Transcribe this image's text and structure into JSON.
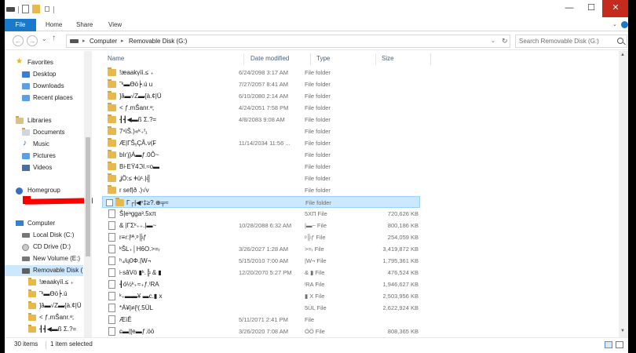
{
  "titlebar": {
    "minimize": "—",
    "maximize": "☐",
    "close": "✕"
  },
  "ribbon": {
    "tabs": [
      "File",
      "Home",
      "Share",
      "View"
    ]
  },
  "address": {
    "crumbs": [
      "Computer",
      "Removable Disk (G:)"
    ],
    "search_placeholder": "Search Removable Disk (G:)"
  },
  "nav": {
    "favorites": "Favorites",
    "desktop": "Desktop",
    "downloads": "Downloads",
    "recent": "Recent places",
    "libraries": "Libraries",
    "documents": "Documents",
    "music": "Music",
    "pictures": "Pictures",
    "videos": "Videos",
    "homegroup": "Homegroup",
    "computer": "Computer",
    "local_disk": "Local Disk (C:)",
    "cd_drive": "CD Drive (D:)",
    "new_volume": "New Volume (E:)",
    "removable": "Removable Disk (",
    "subfolders": [
      "!æaakγïì.≤ ₊",
      "˜ᵏ▬Ɵö┝.ú",
      "]â▬√Z▬{à.¢|Ü",
      "< ƒ.mŠanr.ᵃ;",
      "┨┫◀▬ß Σ.?="
    ]
  },
  "columns": {
    "name": "Name",
    "date": "Date modified",
    "type": "Type",
    "size": "Size"
  },
  "files": [
    {
      "name": "!æaakγïì.≤  ₊",
      "date": "6/24/2098 3:17 AM",
      "type": "File folder",
      "size": "",
      "kind": "folder"
    },
    {
      "name": "˜ᵏ▬Ɵö┝.ú u",
      "date": "7/27/2057 8:41 AM",
      "type": "File folder",
      "size": "",
      "kind": "folder"
    },
    {
      "name": "]â▬√Z▬{à.¢|Ü",
      "date": "6/10/2080 2:14 AM",
      "type": "File folder",
      "size": "",
      "kind": "folder"
    },
    {
      "name": "< ƒ.mŠanr.ᵃ;",
      "date": "4/24/2051 7:58 PM",
      "type": "File folder",
      "size": "",
      "kind": "folder"
    },
    {
      "name": "┨┫◀▬ß Σ.?=",
      "date": "4/8/2083 9:08 AM",
      "type": "File folder",
      "size": "",
      "kind": "folder"
    },
    {
      "name": "7ⁿìŠ.)«ᵏ₊ᶠ₁",
      "date": "",
      "type": "File folder",
      "size": "",
      "kind": "folder"
    },
    {
      "name": "Æ|ΓŠᵧÇÃ.ν(₣",
      "date": "11/14/2034 11:56 ...",
      "type": "File folder",
      "size": "",
      "kind": "folder"
    },
    {
      "name": "bǀɾ'ȷ}Á▬ƒ.0Ô~",
      "date": "",
      "type": "File folder",
      "size": "",
      "kind": "folder"
    },
    {
      "name": "B⊦EŸ4ℑl.≈ο▬",
      "date": "",
      "type": "File folder",
      "size": "",
      "kind": "folder"
    },
    {
      "name": "ʝÖ:≤ ǂù¹.|╣",
      "date": "",
      "type": "File folder",
      "size": "",
      "kind": "folder"
    },
    {
      "name": "r  sef|ð .)√ν",
      "date": "",
      "type": "File folder",
      "size": "",
      "kind": "folder"
    },
    {
      "name": "Γ┌|◀ᵒ‡≥?.⊕╤≈",
      "date": "",
      "type": "File folder",
      "size": "",
      "kind": "folder-selected"
    },
    {
      "name": "Š|eᵃgga³.5xπ",
      "date": "",
      "type": "5XΠ File",
      "size": "720,626 KB",
      "kind": "doc"
    },
    {
      "name": "& |ΓΣᵏ₊₊.|▬~",
      "date": "10/28/2088 6:32 AM",
      "type": "|▬~ File",
      "size": "800,186 KB",
      "kind": "doc"
    },
    {
      "name": "r≡ɾ:|ᴵᴬ.ᵖ╠ƒ",
      "date": "",
      "type": "ᵖ╠ƒ File",
      "size": "254,059 KB",
      "kind": "doc"
    },
    {
      "name": "ᵏŠL₊│H6O.>=ᵣ",
      "date": "3/26/2027 1:28 AM",
      "type": ">=ᵣ File",
      "size": "3,419,872 KB",
      "kind": "doc"
    },
    {
      "name": "ʰ₄/ɥ0Φ.|W¬",
      "date": "5/15/2010 7:00 AM",
      "type": "|W¬ File",
      "size": "1,795,361 KB",
      "kind": "doc"
    },
    {
      "name": "⊦sâVö ▮ᵏ.╠ & ▮",
      "date": "12/20/2070 5:27 PM",
      "type": "& ▮ File",
      "size": "476,524 KB",
      "kind": "doc"
    },
    {
      "name": "┨ó½ᵏ₊≈₊ƒ.ᴵRA",
      "date": "",
      "type": "ᴵRA File",
      "size": "1,946,627 KB",
      "kind": "doc"
    },
    {
      "name": "ᵏ₊▬▬¥ ▬c.▮ x",
      "date": "",
      "type": "▮ X File",
      "size": "2,503,956 KB",
      "kind": "doc"
    },
    {
      "name": "*Á¥|≠{ᴵ(.5ÜL",
      "date": "",
      "type": "5ÜL File",
      "size": "2,622,924 KB",
      "kind": "doc"
    },
    {
      "name": "ÆìÊ",
      "date": "5/11/2071 2:41 PM",
      "type": "File",
      "size": "",
      "kind": "doc"
    },
    {
      "name": "ɕ▬|ʈe▬ƒ.öö",
      "date": "3/26/2020 7:08 AM",
      "type": "ÖÖ File",
      "size": "808,365 KB",
      "kind": "doc"
    }
  ],
  "status": {
    "count": "30 items",
    "selected": "1 item selected"
  }
}
